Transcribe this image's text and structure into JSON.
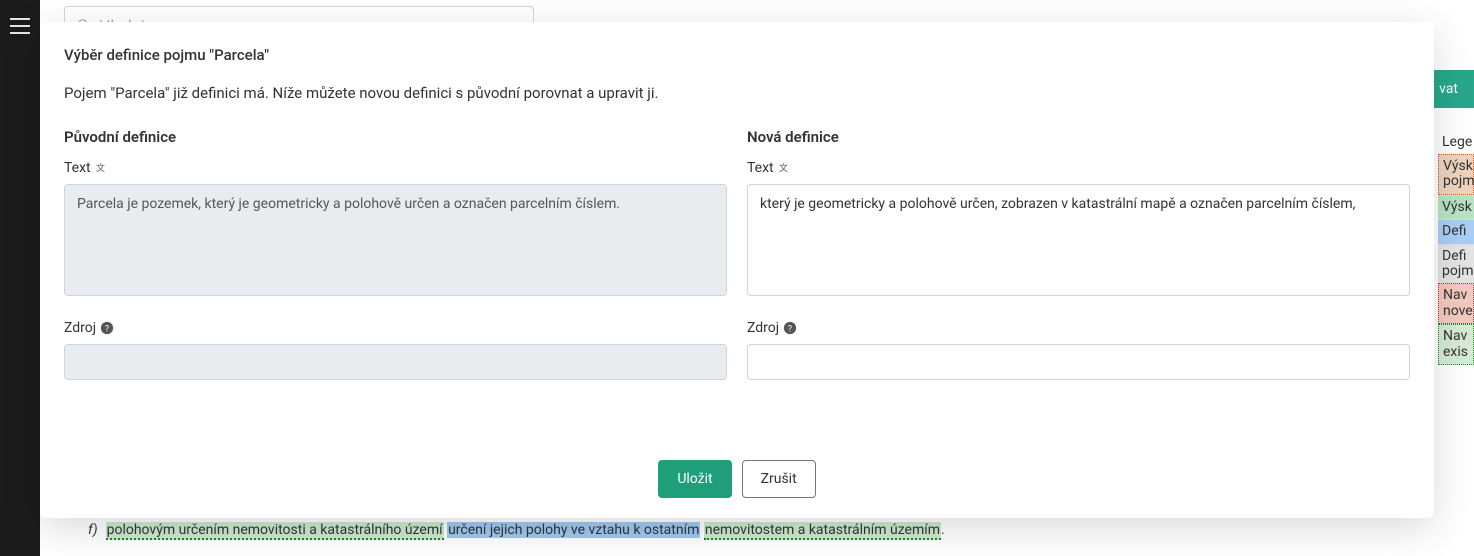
{
  "background": {
    "search_placeholder": "Hledat",
    "sidebar_button_label_fragment": "vat",
    "highlighted_line": {
      "prefix": "f)",
      "seg1": "polohovým určením nemovitosti a katastrálního území",
      "seg2": "určení jejich polohy ve vztahu k ostatním",
      "seg3": "nemovitostem a katastrálním územím"
    },
    "legend": {
      "header": "Lege",
      "rows": [
        "Výsk pojm",
        "Výsk",
        "Defi",
        "Defi pojm",
        "Nav nove",
        "Nav exis"
      ]
    }
  },
  "modal": {
    "title": "Výběr definice pojmu \"Parcela\"",
    "description": "Pojem \"Parcela\" již definici má. Níže můžete novou definici s původní porovnat a upravit ji.",
    "original": {
      "heading": "Původní definice",
      "text_label": "Text",
      "text_value": "Parcela je pozemek, který je geometricky a polohově určen a označen parcelním číslem.",
      "source_label": "Zdroj",
      "source_value": ""
    },
    "new": {
      "heading": "Nová definice",
      "text_label": "Text",
      "text_value": "který je geometricky a polohově určen, zobrazen v katastrální mapě a označen parcelním číslem,",
      "source_label": "Zdroj",
      "source_value": ""
    },
    "buttons": {
      "save": "Uložit",
      "cancel": "Zrušit"
    }
  }
}
